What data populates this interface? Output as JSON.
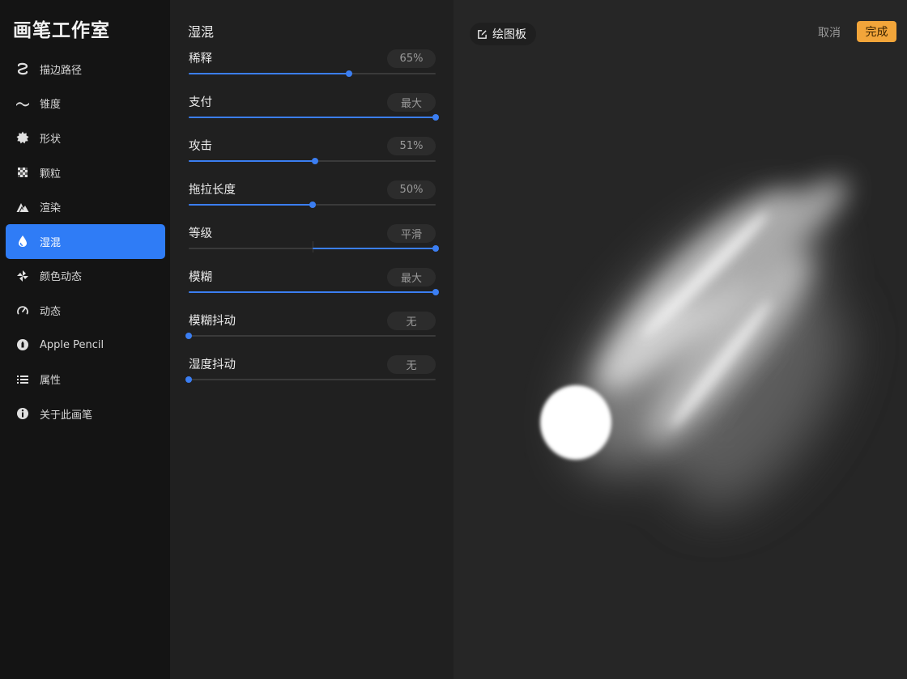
{
  "app": {
    "title": "画笔工作室"
  },
  "sidebar": {
    "items": [
      {
        "label": "描边路径",
        "icon": "stroke-path-icon",
        "active": false
      },
      {
        "label": "锥度",
        "icon": "taper-wave-icon",
        "active": false
      },
      {
        "label": "形状",
        "icon": "shape-gear-icon",
        "active": false
      },
      {
        "label": "颗粒",
        "icon": "grain-checker-icon",
        "active": false
      },
      {
        "label": "渲染",
        "icon": "render-mountain-icon",
        "active": false
      },
      {
        "label": "湿混",
        "icon": "wet-mix-drop-icon",
        "active": true
      },
      {
        "label": "颜色动态",
        "icon": "color-pinwheel-icon",
        "active": false
      },
      {
        "label": "动态",
        "icon": "dynamics-gauge-icon",
        "active": false
      },
      {
        "label": "Apple Pencil",
        "icon": "apple-pencil-icon",
        "active": false
      },
      {
        "label": "属性",
        "icon": "properties-list-icon",
        "active": false
      },
      {
        "label": "关于此画笔",
        "icon": "info-icon",
        "active": false
      }
    ]
  },
  "panel": {
    "title": "湿混",
    "settings": [
      {
        "label": "稀释",
        "value": "65%",
        "level": 0.65,
        "bipolar": false
      },
      {
        "label": "支付",
        "value": "最大",
        "level": 1.0,
        "bipolar": false
      },
      {
        "label": "攻击",
        "value": "51%",
        "level": 0.51,
        "bipolar": false
      },
      {
        "label": "拖拉长度",
        "value": "50%",
        "level": 0.5,
        "bipolar": false
      },
      {
        "label": "等级",
        "value": "平滑",
        "level": 1.0,
        "bipolar": true
      },
      {
        "label": "模糊",
        "value": "最大",
        "level": 1.0,
        "bipolar": false
      },
      {
        "label": "模糊抖动",
        "value": "无",
        "level": 0.0,
        "bipolar": false
      },
      {
        "label": "湿度抖动",
        "value": "无",
        "level": 0.0,
        "bipolar": false
      }
    ]
  },
  "canvas": {
    "pad_label": "绘图板",
    "pad_icon": "edit-pad-icon",
    "cancel_label": "取消",
    "done_label": "完成"
  },
  "colors": {
    "accent_blue": "#2f7cf6",
    "done_orange": "#f2a53a",
    "sidebar_bg": "#141414",
    "panel_bg": "#202020",
    "canvas_bg": "#262626"
  }
}
